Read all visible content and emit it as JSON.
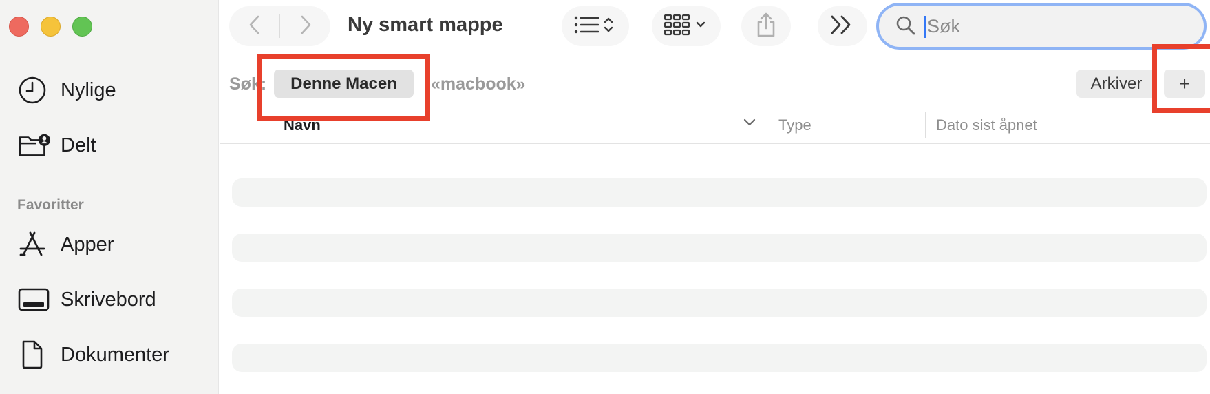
{
  "window": {
    "title": "Ny smart mappe"
  },
  "sidebar": {
    "items": [
      {
        "label": "Nylige",
        "icon": "clock-icon"
      },
      {
        "label": "Delt",
        "icon": "shared-folder-icon"
      }
    ],
    "favorites_title": "Favoritter",
    "favorites": [
      {
        "label": "Apper",
        "icon": "apps-icon"
      },
      {
        "label": "Skrivebord",
        "icon": "desktop-icon"
      },
      {
        "label": "Dokumenter",
        "icon": "document-icon"
      }
    ]
  },
  "toolbar": {
    "search_placeholder": "Søk"
  },
  "scope_bar": {
    "label": "Søk:",
    "selected": "Denne Macen",
    "alternative": "«macbook»",
    "archive_button": "Arkiver",
    "add_button": "+"
  },
  "columns": {
    "name": "Navn",
    "type": "Type",
    "date": "Dato sist åpnet"
  },
  "colors": {
    "highlight": "#e8402c",
    "search_focus": "#8fb4f5"
  }
}
